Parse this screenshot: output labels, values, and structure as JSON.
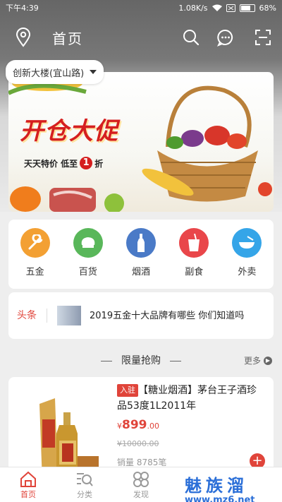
{
  "status_bar": {
    "time": "下午4:39",
    "speed": "1.08K/s",
    "battery": "68%"
  },
  "header": {
    "title": "首页",
    "icons": [
      "location-icon",
      "search-icon",
      "message-icon",
      "scan-icon"
    ]
  },
  "location": {
    "address": "创新大楼(宜山路)"
  },
  "banner": {
    "title": "开仓大促",
    "subtitle_prefix": "天天特价 低至",
    "subtitle_number": "1",
    "subtitle_suffix": "折"
  },
  "categories": [
    {
      "label": "五金",
      "icon": "wrench-icon",
      "color": "#f3a033"
    },
    {
      "label": "百货",
      "icon": "store-icon",
      "color": "#59b75a"
    },
    {
      "label": "烟酒",
      "icon": "bottle-icon",
      "color": "#4a7ac7"
    },
    {
      "label": "副食",
      "icon": "drink-cup-icon",
      "color": "#e9464a"
    },
    {
      "label": "外卖",
      "icon": "bowl-icon",
      "color": "#35a5e8"
    }
  ],
  "headline": {
    "tag": "头条",
    "text": "2019五金十大品牌有哪些 你们知道吗"
  },
  "flash_sale": {
    "title": "限量抢购",
    "more": "更多"
  },
  "product": {
    "badge": "入驻",
    "name": "【糖业烟酒】茅台王子酒珍品53度1L2011年",
    "price_symbol": "¥",
    "price_int": "899",
    "price_dec": ".00",
    "original_price": "¥10000.00",
    "sales": "销量 8785笔"
  },
  "tabs": [
    {
      "label": "首页",
      "icon": "home-icon",
      "active": true
    },
    {
      "label": "分类",
      "icon": "category-search-icon",
      "active": false
    },
    {
      "label": "发现",
      "icon": "discover-icon",
      "active": false
    },
    {
      "label": "",
      "icon": "hidden-tab-icon",
      "active": false
    },
    {
      "label": "",
      "icon": "hidden-tab-icon",
      "active": false
    }
  ],
  "watermark": {
    "text": "魅族溜",
    "url": "www.mz6.net"
  },
  "colors": {
    "accent": "#e0443a",
    "watermark": "#2b6fd8"
  }
}
